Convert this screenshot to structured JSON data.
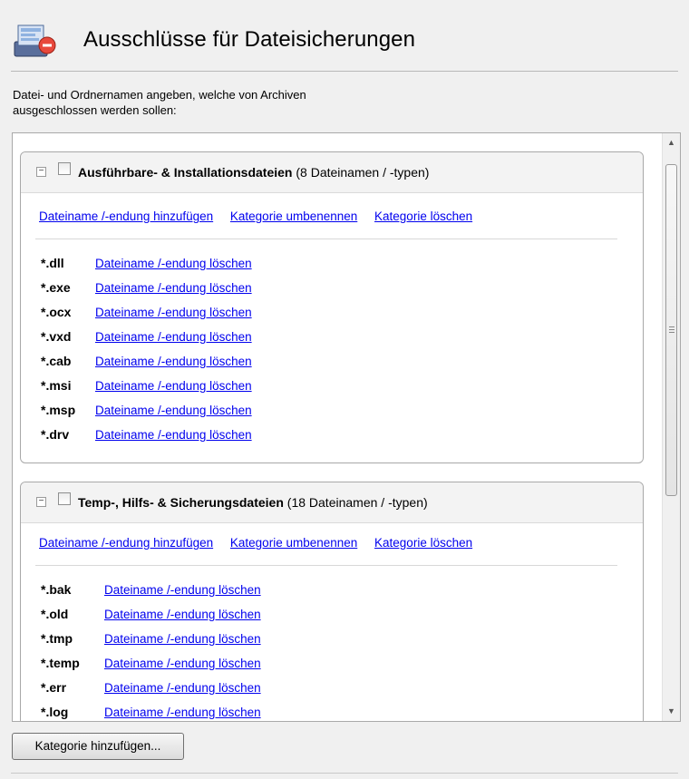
{
  "header": {
    "title": "Ausschlüsse für Dateisicherungen",
    "icon": "backup-exclusion-icon"
  },
  "description": {
    "line1": "Datei- und Ordnernamen angeben, welche von Archiven",
    "line2": "ausgeschlossen werden sollen:"
  },
  "links": {
    "add": "Dateiname /-endung hinzufügen",
    "rename": "Kategorie umbenennen",
    "delete_category": "Kategorie löschen",
    "delete_item": "Dateiname /-endung löschen"
  },
  "categories": [
    {
      "name": "Ausführbare- & Installationsdateien",
      "count": "(8 Dateinamen / -typen)",
      "items": [
        "*.dll",
        "*.exe",
        "*.ocx",
        "*.vxd",
        "*.cab",
        "*.msi",
        "*.msp",
        "*.drv"
      ]
    },
    {
      "name": "Temp-, Hilfs- & Sicherungsdateien",
      "count": "(18 Dateinamen / -typen)",
      "items": [
        "*.bak",
        "*.old",
        "*.tmp",
        "*.temp",
        "*.err",
        "*.log"
      ]
    }
  ],
  "footer": {
    "add_category": "Kategorie hinzufügen..."
  },
  "colors": {
    "link": "#0000ee",
    "panel_border": "#a9a9a9"
  }
}
